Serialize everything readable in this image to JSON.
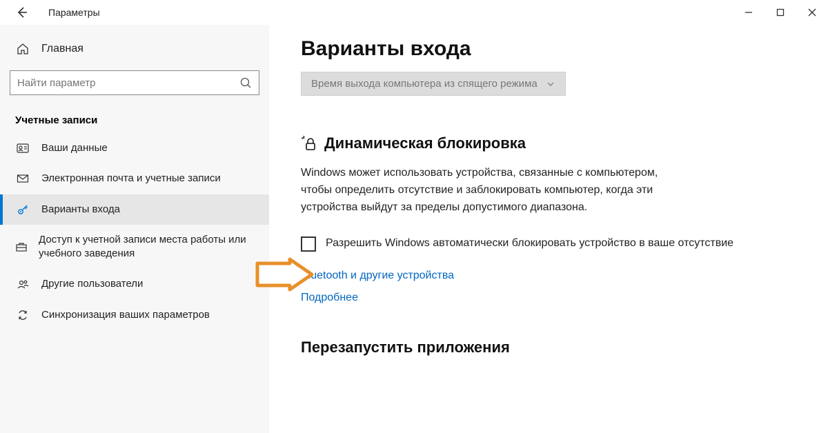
{
  "titlebar": {
    "title": "Параметры"
  },
  "sidebar": {
    "home": "Главная",
    "search_placeholder": "Найти параметр",
    "category": "Учетные записи",
    "items": [
      {
        "label": "Ваши данные"
      },
      {
        "label": "Электронная почта и учетные записи"
      },
      {
        "label": "Варианты входа"
      },
      {
        "label": "Доступ к учетной записи места работы или учебного заведения"
      },
      {
        "label": "Другие пользователи"
      },
      {
        "label": "Синхронизация ваших параметров"
      }
    ]
  },
  "content": {
    "page_title": "Варианты входа",
    "dropdown_label": "Время выхода компьютера из спящего режима",
    "dyn_lock_title": "Динамическая блокировка",
    "dyn_lock_desc": "Windows может использовать устройства, связанные с компьютером, чтобы определить отсутствие и заблокировать компьютер, когда эти устройства выйдут за пределы допустимого диапазона.",
    "checkbox_label": "Разрешить Windows автоматически блокировать устройство в ваше отсутствие",
    "link_bluetooth": "Bluetooth и другие устройства",
    "link_more": "Подробнее",
    "restart_apps_title": "Перезапустить приложения"
  }
}
